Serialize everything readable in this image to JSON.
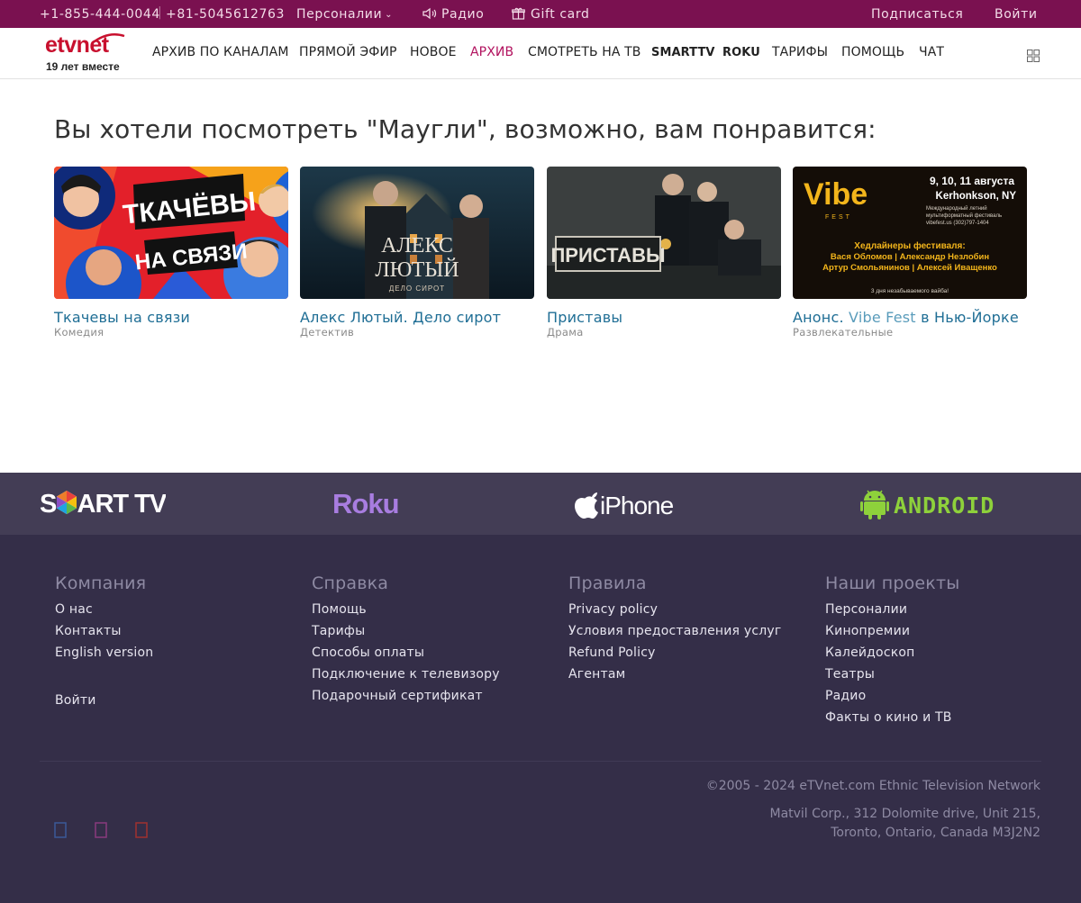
{
  "topbar": {
    "phone1": "+1-855-444-0044",
    "separator": "|",
    "phone2": "+81-5045612763",
    "personali": "Персоналии",
    "radio": "Радио",
    "gift_card": "Gift card",
    "subscribe": "Подписаться",
    "login": "Войти"
  },
  "logo": {
    "word": "etvnet",
    "tagline": "19 лет вместе"
  },
  "nav": {
    "items": [
      {
        "label": "АРХИВ ПО КАНАЛАМ",
        "active": false
      },
      {
        "label": "ПРЯМОЙ ЭФИР",
        "active": false
      },
      {
        "label": "НОВОЕ",
        "active": false
      },
      {
        "label": "АРХИВ",
        "active": true
      },
      {
        "label": "СМОТРЕТЬ НА ТВ",
        "active": false
      },
      {
        "label": "SMARTTV",
        "active": false
      },
      {
        "label": "ROKU",
        "active": false
      },
      {
        "label": "ТАРИФЫ",
        "active": false
      },
      {
        "label": "ПОМОЩЬ",
        "active": false
      },
      {
        "label": "ЧАТ",
        "active": false
      }
    ],
    "accent_color": "#b2135f"
  },
  "main": {
    "heading": "Вы хотели посмотреть \"Маугли\", возможно, вам понравится:",
    "cards": [
      {
        "title": "Ткачевы на связи",
        "genre": "Комедия",
        "thumb_text_1": "ТКАЧЁВЫ",
        "thumb_text_2": "НА СВЯЗИ"
      },
      {
        "title": "Алекс Лютый. Дело сирот",
        "genre": "Детектив",
        "thumb_text_1": "АЛЕКС",
        "thumb_text_2": "ЛЮТЫЙ",
        "thumb_text_3": "ДЕЛО СИРОТ"
      },
      {
        "title": "Приставы",
        "genre": "Драма",
        "thumb_text_1": "ПРИСТАВЫ"
      },
      {
        "title_a": "Анонс.",
        "title_b": "Vibe Fest",
        "title_c": "в Нью-Йорке",
        "genre": "Развлекательные",
        "poster": {
          "brand": "Vibe",
          "brand_sub": "FEST",
          "dates": "9, 10, 11 августа",
          "place": "Kerhonkson, NY",
          "desc1": "Международный летний",
          "desc2": "мультиформатный фестиваль",
          "desc3": "vibefest.us (302)797-1404",
          "headliners": "Хедлайнеры фестиваля:",
          "names1": "Вася Обломов | Александр Незлобин",
          "names2": "Артур Смольянинов | Алексей Иващенко",
          "footer": "3 дня незабываемого вайба!"
        }
      }
    ]
  },
  "platforms": {
    "smart_tv": "SMART TV",
    "roku": "Roku",
    "iphone": "iPhone",
    "android": "ANDROID"
  },
  "footer": {
    "columns": [
      {
        "title": "Компания",
        "links": [
          "О нас",
          "Контакты",
          "English version"
        ]
      },
      {
        "title": "Справка",
        "links": [
          "Помощь",
          "Тарифы",
          "Способы оплаты",
          "Подключение к телевизору",
          "Подарочный сертификат"
        ]
      },
      {
        "title": "Правила",
        "links": [
          "Privacy policy",
          "Условия предоставления услуг",
          "Refund Policy",
          "Агентам"
        ]
      },
      {
        "title": "Наши проекты",
        "links": [
          "Персоналии",
          "Кинопремии",
          "Калейдоскоп",
          "Театры",
          "Радио",
          "Факты о кино и ТВ"
        ]
      }
    ],
    "login": "Войти",
    "copyright": "©2005 - 2024 eTVnet.com Ethnic Television Network",
    "address_line1": "Matvil Corp., 312 Dolomite drive, Unit 215,",
    "address_line2": "Toronto, Ontario, Canada M3J2N2",
    "social_icons": [
      "facebook-icon",
      "instagram-icon",
      "youtube-icon"
    ]
  }
}
